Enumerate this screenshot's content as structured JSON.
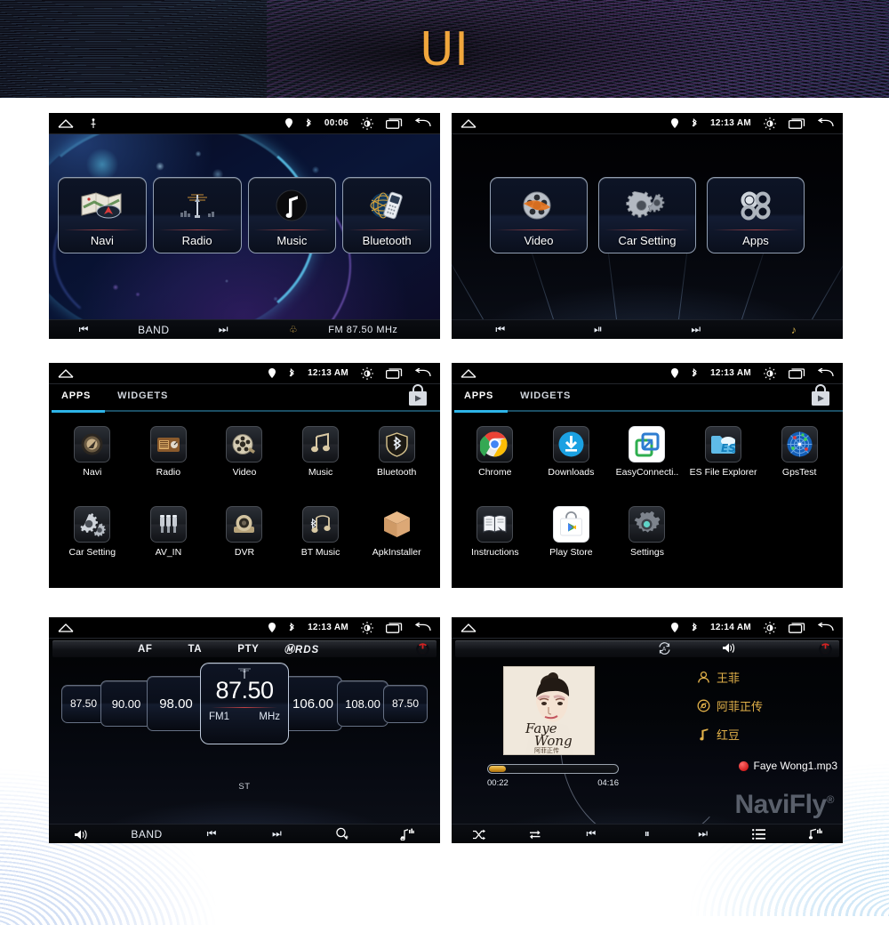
{
  "banner": {
    "title": "UI"
  },
  "screens": {
    "home1": {
      "status": {
        "time": "00:06",
        "icons": [
          "home-icon",
          "usb-icon",
          "gps-icon",
          "bluetooth-icon",
          "brightness-icon",
          "recents-icon",
          "back-icon"
        ]
      },
      "tiles": [
        {
          "label": "Navi",
          "icon": "map-navigation-icon"
        },
        {
          "label": "Radio",
          "icon": "radio-tower-icon"
        },
        {
          "label": "Music",
          "icon": "music-note-icon"
        },
        {
          "label": "Bluetooth",
          "icon": "bluetooth-phone-icon"
        }
      ],
      "bottom": {
        "prev": "prev-icon",
        "band": "BAND",
        "next": "next-icon",
        "signal": "signal-icon",
        "freq": "FM 87.50 MHz"
      }
    },
    "home2": {
      "status": {
        "time": "12:13 AM"
      },
      "tiles": [
        {
          "label": "Video",
          "icon": "film-reel-icon"
        },
        {
          "label": "Car Setting",
          "icon": "gears-icon"
        },
        {
          "label": "Apps",
          "icon": "apps-rings-icon"
        }
      ],
      "bottom": {
        "prev": "prev-icon",
        "playpause": "play-pause-icon",
        "next": "next-icon",
        "music": "music-note-icon"
      }
    },
    "drawer1": {
      "status": {
        "time": "12:13 AM"
      },
      "tabs": [
        {
          "label": "APPS",
          "active": true
        },
        {
          "label": "WIDGETS",
          "active": false
        }
      ],
      "store_icon": "play-store-bag-icon",
      "apps": [
        {
          "label": "Navi",
          "icon": "compass-globe-icon"
        },
        {
          "label": "Radio",
          "icon": "retro-radio-icon"
        },
        {
          "label": "Video",
          "icon": "film-reel-icon"
        },
        {
          "label": "Music",
          "icon": "music-notes-icon"
        },
        {
          "label": "Bluetooth",
          "icon": "bluetooth-shield-icon"
        },
        {
          "label": "Car Setting",
          "icon": "gears-icon"
        },
        {
          "label": "AV_IN",
          "icon": "rca-plugs-icon"
        },
        {
          "label": "DVR",
          "icon": "dash-camera-icon"
        },
        {
          "label": "BT Music",
          "icon": "bt-music-icon"
        },
        {
          "label": "ApkInstaller",
          "icon": "package-box-icon"
        }
      ]
    },
    "drawer2": {
      "status": {
        "time": "12:13 AM"
      },
      "tabs": [
        {
          "label": "APPS",
          "active": true
        },
        {
          "label": "WIDGETS",
          "active": false
        }
      ],
      "store_icon": "play-store-bag-icon",
      "apps": [
        {
          "label": "Chrome",
          "icon": "chrome-icon"
        },
        {
          "label": "Downloads",
          "icon": "download-circle-icon"
        },
        {
          "label": "EasyConnecti..",
          "icon": "easyconnection-icon"
        },
        {
          "label": "ES File Explorer",
          "icon": "es-file-explorer-icon"
        },
        {
          "label": "GpsTest",
          "icon": "gps-radar-icon"
        },
        {
          "label": "Instructions",
          "icon": "open-book-icon"
        },
        {
          "label": "Play Store",
          "icon": "play-store-bag-icon"
        },
        {
          "label": "Settings",
          "icon": "settings-gear-icon"
        }
      ]
    },
    "radio": {
      "status": {
        "time": "12:13 AM"
      },
      "toolbar": [
        "AF",
        "TA",
        "PTY",
        "RDS"
      ],
      "power_icon": "power-icon",
      "presets_left": [
        {
          "value": "87.50",
          "size": "far"
        },
        {
          "value": "90.00",
          "size": "mid"
        },
        {
          "value": "98.00",
          "size": "near"
        }
      ],
      "center": {
        "frequency": "87.50",
        "band": "FM1",
        "unit": "MHz",
        "antenna_icon": "antenna-icon"
      },
      "presets_right": [
        {
          "value": "106.00",
          "size": "near"
        },
        {
          "value": "108.00",
          "size": "mid"
        },
        {
          "value": "87.50",
          "size": "far"
        }
      ],
      "stereo_label": "ST",
      "bottom": [
        {
          "icon": "volume-icon",
          "label": ""
        },
        {
          "icon": "",
          "label": "BAND"
        },
        {
          "icon": "prev-icon",
          "label": ""
        },
        {
          "icon": "next-icon",
          "label": ""
        },
        {
          "icon": "scan-search-icon",
          "label": ""
        },
        {
          "icon": "equalizer-icon",
          "label": ""
        }
      ]
    },
    "music": {
      "status": {
        "time": "12:14 AM"
      },
      "toolbar": {
        "repeat_icon": "auto-repeat-icon",
        "volume_icon": "volume-icon",
        "power_icon": "power-icon"
      },
      "album_art": {
        "title": "Faye Wong",
        "subtitle": "阿菲正传"
      },
      "info": [
        {
          "icon": "artist-icon",
          "text": "王菲"
        },
        {
          "icon": "album-icon",
          "text": "阿菲正传"
        },
        {
          "icon": "song-icon",
          "text": "红豆"
        }
      ],
      "file": {
        "name": "Faye Wong1.mp3",
        "icon": "record-dot-icon"
      },
      "progress": {
        "elapsed": "00:22",
        "total": "04:16",
        "percent": 13
      },
      "watermark": {
        "text": "NaviFly",
        "mark": "®"
      },
      "bottom": [
        "shuffle-icon",
        "repeat-icon",
        "prev-icon",
        "pause-icon",
        "next-icon",
        "playlist-icon",
        "equalizer-icon"
      ]
    }
  }
}
